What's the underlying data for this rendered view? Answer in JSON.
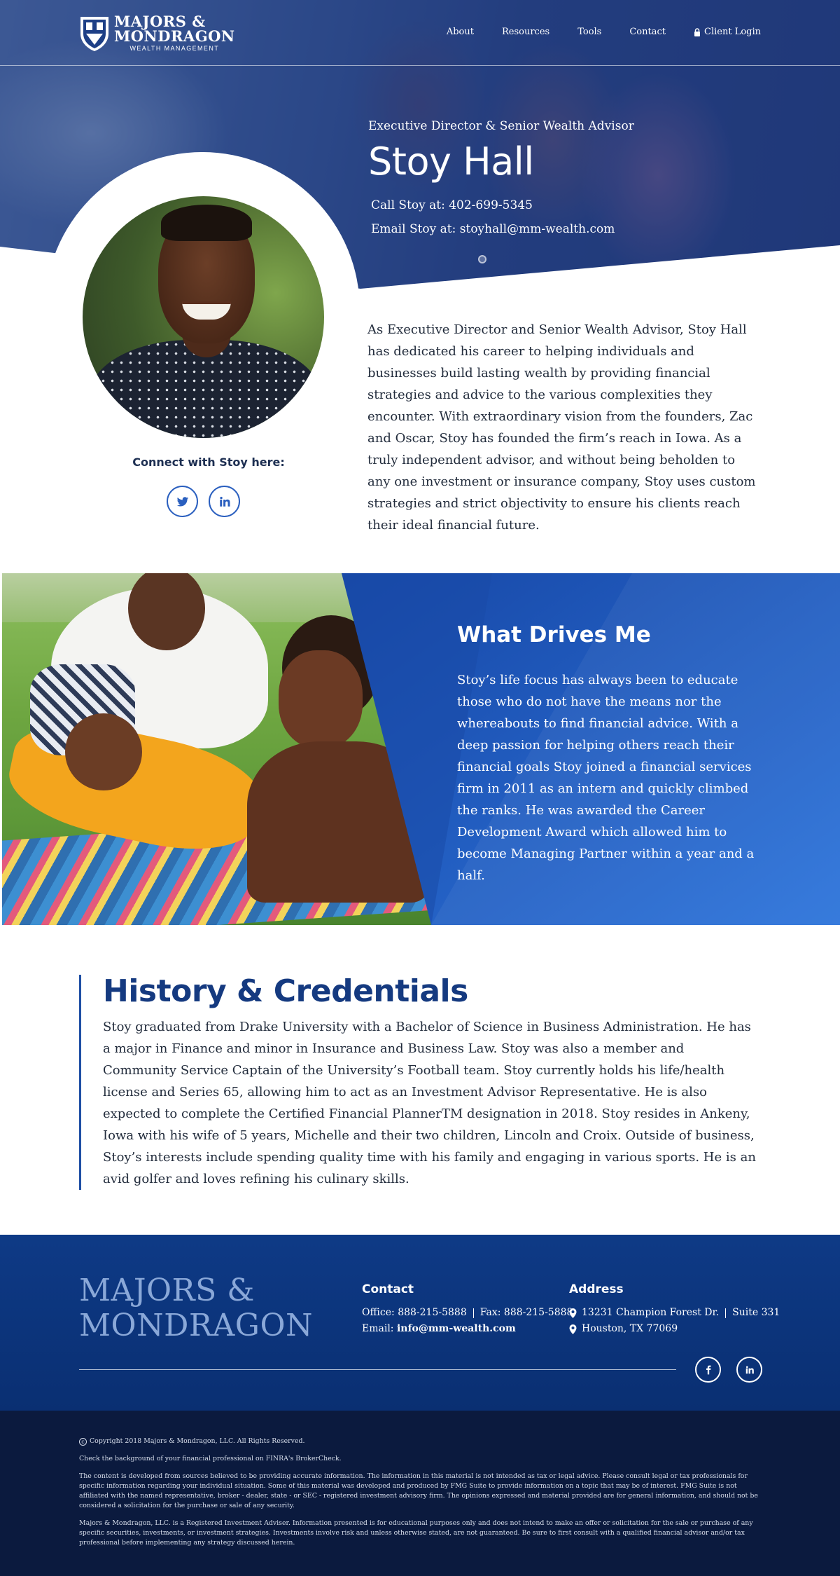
{
  "header": {
    "logo": {
      "line1": "MAJORS &",
      "line2": "MONDRAGON",
      "line3": "WEALTH MANAGEMENT"
    },
    "nav": [
      "About",
      "Resources",
      "Tools",
      "Contact"
    ],
    "client_login": "Client Login"
  },
  "hero": {
    "role": "Executive Director & Senior Wealth Advisor",
    "name": "Stoy Hall",
    "call": "Call Stoy at: 402-699-5345",
    "email": "Email Stoy at: stoyhall@mm-wealth.com"
  },
  "profile": {
    "connect_label": "Connect with Stoy here:",
    "social": [
      "twitter-icon",
      "linkedin-icon"
    ]
  },
  "bio": "As Executive Director and Senior Wealth Advisor, Stoy Hall has dedicated his career to helping individuals and businesses build lasting wealth by providing financial strategies and advice to the various complexities they encounter.  With extraordinary vision from the founders, Zac and Oscar, Stoy has founded the firm’s reach in Iowa.  As a truly independent advisor, and without being beholden to any one investment or insurance company, Stoy uses custom strategies and strict objectivity to ensure his clients reach their ideal financial future.",
  "drives": {
    "title": "What Drives Me",
    "text": "Stoy’s life focus has always been to educate those who do not have the means nor the whereabouts to find financial advice.  With a deep passion for helping others reach their financial goals Stoy joined a financial services firm in 2011 as an intern and quickly climbed the ranks.  He was awarded the Career Development Award which allowed him to become Managing Partner within a year and a half."
  },
  "history": {
    "title": "History & Credentials",
    "text": "Stoy graduated from Drake University with a Bachelor of Science in Business Administration. He has a major in Finance and minor in Insurance and Business Law. Stoy was also a member and Community Service Captain of the University’s Football team.  Stoy currently holds his life/health license and Series 65, allowing him to act as an Investment Advisor Representative. He is also expected to complete the Certified Financial PlannerTM designation in 2018. Stoy resides in Ankeny, Iowa with his wife of 5 years, Michelle and their two children, Lincoln and Croix.  Outside of business, Stoy’s interests include spending quality time with his family and engaging in various sports. He is an avid golfer and loves refining his culinary skills."
  },
  "footer": {
    "logo_line1": "MAJORS &",
    "logo_line2": "MONDRAGON",
    "contact": {
      "heading": "Contact",
      "office": "Office: 888-215-5888",
      "fax": "Fax: 888-215-5888",
      "email_label": "Email:",
      "email": "info@mm-wealth.com"
    },
    "address": {
      "heading": "Address",
      "street": "13231 Champion Forest Dr.",
      "suite": "Suite 331",
      "city": "Houston, TX 77069"
    },
    "social": [
      "facebook-icon",
      "linkedin-icon"
    ]
  },
  "legal": {
    "copyright": "Copyright 2018 Majors & Mondragon, LLC. All Rights Reserved.",
    "finra": "Check the background of your financial professional on FINRA's BrokerCheck.",
    "disclaimer1": "The content is developed from sources believed to be providing accurate information. The information in this material is not intended as tax or legal advice. Please consult legal or tax professionals for specific information regarding your individual situation. Some of this material was developed and produced by FMG Suite to provide information on a topic that may be of interest. FMG Suite is not affiliated with the named representative, broker - dealer, state - or SEC - registered investment advisory firm. The opinions expressed and material provided are for general information, and should not be considered a solicitation for the purchase or sale of any security.",
    "disclaimer2": "Majors & Mondragon, LLC. is a Registered Investment Adviser. Information presented is for educational purposes only and does not intend to make an offer or solicitation for the sale or purchase of any specific securities, investments, or investment strategies. Investments involve risk and unless otherwise stated, are not guaranteed. Be sure to first consult with a qualified financial advisor and/or tax professional before implementing any strategy discussed herein."
  },
  "colors": {
    "brand_blue": "#1f4fa5",
    "heading_blue": "#153a80",
    "footer_blue": "#0e3a86",
    "legal_navy": "#0b1a3e"
  }
}
